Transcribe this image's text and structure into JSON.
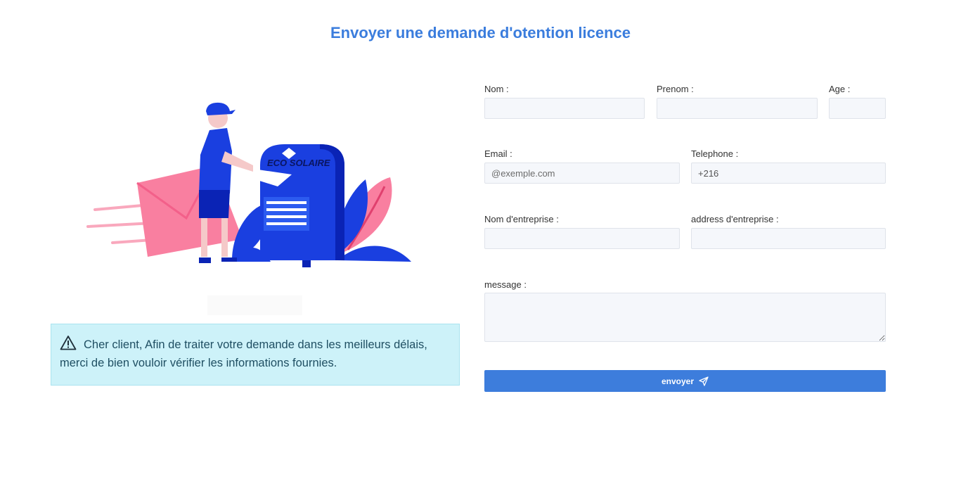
{
  "page": {
    "title": "Envoyer une demande d'otention licence"
  },
  "illustration": {
    "mailbox_brand": "ECO SOLAIRE"
  },
  "alert": {
    "icon": "warning-triangle-icon",
    "text": "Cher client, Afin de traiter votre demande dans les meilleurs délais, merci de bien vouloir vérifier les informations fournies."
  },
  "form": {
    "nom": {
      "label": "Nom :",
      "value": "",
      "placeholder": ""
    },
    "prenom": {
      "label": "Prenom :",
      "value": "",
      "placeholder": ""
    },
    "age": {
      "label": "Age :",
      "value": "",
      "placeholder": ""
    },
    "email": {
      "label": "Email :",
      "value": "",
      "placeholder": "@exemple.com"
    },
    "telephone": {
      "label": "Telephone :",
      "value": "+216",
      "placeholder": ""
    },
    "company_name": {
      "label": "Nom d'entreprise :",
      "value": "",
      "placeholder": ""
    },
    "company_address": {
      "label": "address d'entreprise :",
      "value": "",
      "placeholder": ""
    },
    "message": {
      "label": "message :",
      "value": "",
      "placeholder": ""
    },
    "submit": {
      "label": "envoyer",
      "icon": "send-icon"
    }
  },
  "colors": {
    "accent": "#3b7ddd",
    "alert_bg": "#cdf2f9",
    "illus_blue": "#1a3fe0",
    "illus_pink": "#f97fa0"
  }
}
